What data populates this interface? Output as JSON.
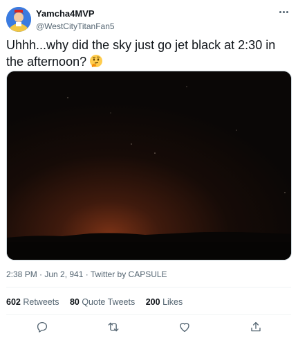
{
  "user": {
    "display_name": "Yamcha4MVP",
    "handle": "@WestCityTitanFan5"
  },
  "tweet": {
    "text": "Uhhh...why did the sky just go jet black at 2:30 in the afternoon?",
    "emoji": "thinking-face-emoji"
  },
  "meta": {
    "time": "2:38 PM · Jun 2, 941 · ",
    "source": "Twitter by CAPSULE"
  },
  "stats": {
    "retweets_count": "602",
    "retweets_label": "Retweets",
    "quotes_count": "80",
    "quotes_label": "Quote Tweets",
    "likes_count": "200",
    "likes_label": "Likes"
  },
  "icons": {
    "more": "more-horizontal-icon",
    "reply": "reply-icon",
    "retweet": "retweet-icon",
    "like": "heart-icon",
    "share": "share-icon"
  },
  "colors": {
    "text": "#0f1419",
    "secondary": "#536471",
    "divider": "#eff3f4",
    "image_sky": "#0a0706",
    "horizon_glow": "#6b2a12"
  }
}
